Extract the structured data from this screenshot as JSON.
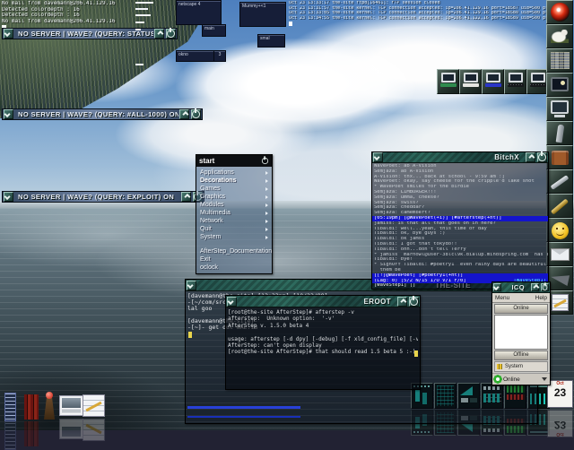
{
  "console": {
    "lines": [
      "No mail from davemann@206.41.129.16",
      "Detected colordepth : 16",
      "Detected colordepth : 16",
      "No mail from davemann@206.41.129.16"
    ]
  },
  "syslog": {
    "lines": [
      "Oct 23 13:33:17 the-site ftpd[16461]: FTP session closed",
      "Oct 23 13:31:57 the-site kernel: TCP connection accepted: ip=206.41.129.16 port=18587 uid=500 process=wu.ftpd[16129]",
      "Oct 23 13:33:05 the-site kernel: TCP connection accepted: ip=206.41.129.16 port=18580 uid=500 process=wu.ftpd[16129]",
      "Oct 23 13:34:55 the-site kernel: TCP connection accepted: ip=206.41.122.16 port=18589 uid=500 process=wu.ftpd[16129]"
    ]
  },
  "shaded_bars": [
    {
      "title": "NO SERVER | WAVE? (QUERY: STATUS) ON"
    },
    {
      "title": "NO SERVER | WAVE? (QUERY: #ALL-1000) ON"
    },
    {
      "title": "NO SERVER | WAVE? (QUERY: EXPLOIT) ON"
    }
  ],
  "mini_windows": {
    "netscape": "netscape 4",
    "main": "main",
    "okno": "okno",
    "okno_badge": "3",
    "mummy": "Mummy+<1",
    "smal": "smal"
  },
  "start_menu": {
    "title": "start",
    "items": [
      "Applications",
      "Decorations",
      "Games",
      "Graphics",
      "Modules",
      "Multimedia",
      "Network",
      "Quit",
      "System"
    ],
    "footer": [
      "AfterStep_Documentation",
      "Exit",
      "oclock"
    ]
  },
  "irc": {
    "title": "BitchX",
    "lines_top": [
      "WavePoet: ab A-Vision",
      "Semjaza: ab A-Vision",
      "A-Vision: tnx... back at school - 9:59 am :]",
      "WavePoet: okay, say cheese for the cripple'd lake shot",
      "* WavePoet smiles for the birdie",
      "Semjaza: LIMBURGER!!!",
      "Semjaza: umma, cheese?",
      "Semjaza: swiss?",
      "Semjaza: cheddar?",
      "Semjaza: camembert?"
    ],
    "status_top": "[05:19pm] [@WavePoet(+i)] [#afterstep(+nt)]",
    "lines_bottom": [
      "jamiss: is that all that goes on in here?",
      "Tibaldi: well...yeah, this time of day",
      "Tibaldi: ok, bye guys :)",
      "Tibaldi: ok jamss",
      "Tibaldi: I got that tokydo!!",
      "Tibaldi: ohh...don't tell Terry",
      "* jamiss  marhowl@user-38lcl9k.dialup.mindspring.com  has left #poetry1",
      "Tibaldi: bye!",
      "* SignOff Tibaldi: #poetry1  even rainy days are beautiful to those who let",
      "  them be"
    ],
    "status_mid": "[[!]@WavePoet] [#poetry1(+nt)]",
    "status_lag": "(Lag: 0) [5/2 N/15 I/O V/1 F/0]",
    "status_nick": "[WaveStep1]",
    "input": "[WaveStep1] []"
  },
  "terminal_site": {
    "title": "THE-SITE",
    "lines": [
      "[davemann@the-site]-[13:33pm]-[10/23/99]-",
      "-[~/com/src/cripple]-",
      "lal goo",
      "",
      "[davemann@the-site]-",
      "-[~]- get out WAL.IB"
    ]
  },
  "terminal_root": {
    "title": "EROOT",
    "lines": [
      "[root@the-site AfterStep]# afterstep -v",
      "afterstep:  Unknown option:  '-v'",
      "AfterStep v. 1.5.0 beta 4",
      "",
      "usage: afterstep [-d dpy] [-debug] [-f xld_config_file] [-v]",
      "AfterStep: can't open display",
      "[root@the-site AfterStep]# that should read 1.5 beta 5 :-)"
    ]
  },
  "icq": {
    "title": "ICQ",
    "menu_label": "Menu",
    "help_label": "Help",
    "online_header": "Online",
    "offline_header": "Offline",
    "system_label": "System",
    "status_label": "Online"
  },
  "docks": {
    "right_icons": [
      "hal-eye",
      "dove",
      "city-monitor",
      "night-monitor",
      "monitor",
      "rocket",
      "book",
      "pencil",
      "gold-pen",
      "smiley",
      "mail",
      "stealth-plane",
      "notepad"
    ],
    "computer_row": [
      "computer-green",
      "computer-white",
      "computer-blue",
      "workstation-black-1",
      "workstation-black-2"
    ],
    "bottom_tiles": [
      "cpu-monitor",
      "mem-monitor",
      "load-monitor",
      "modem-monitor",
      "net-monitor",
      "traffic-monitor"
    ],
    "calendar_month": "Oct",
    "calendar_day": "23"
  },
  "desk_icons": [
    "asmail",
    "library",
    "statue",
    "postcard",
    "notepad"
  ]
}
